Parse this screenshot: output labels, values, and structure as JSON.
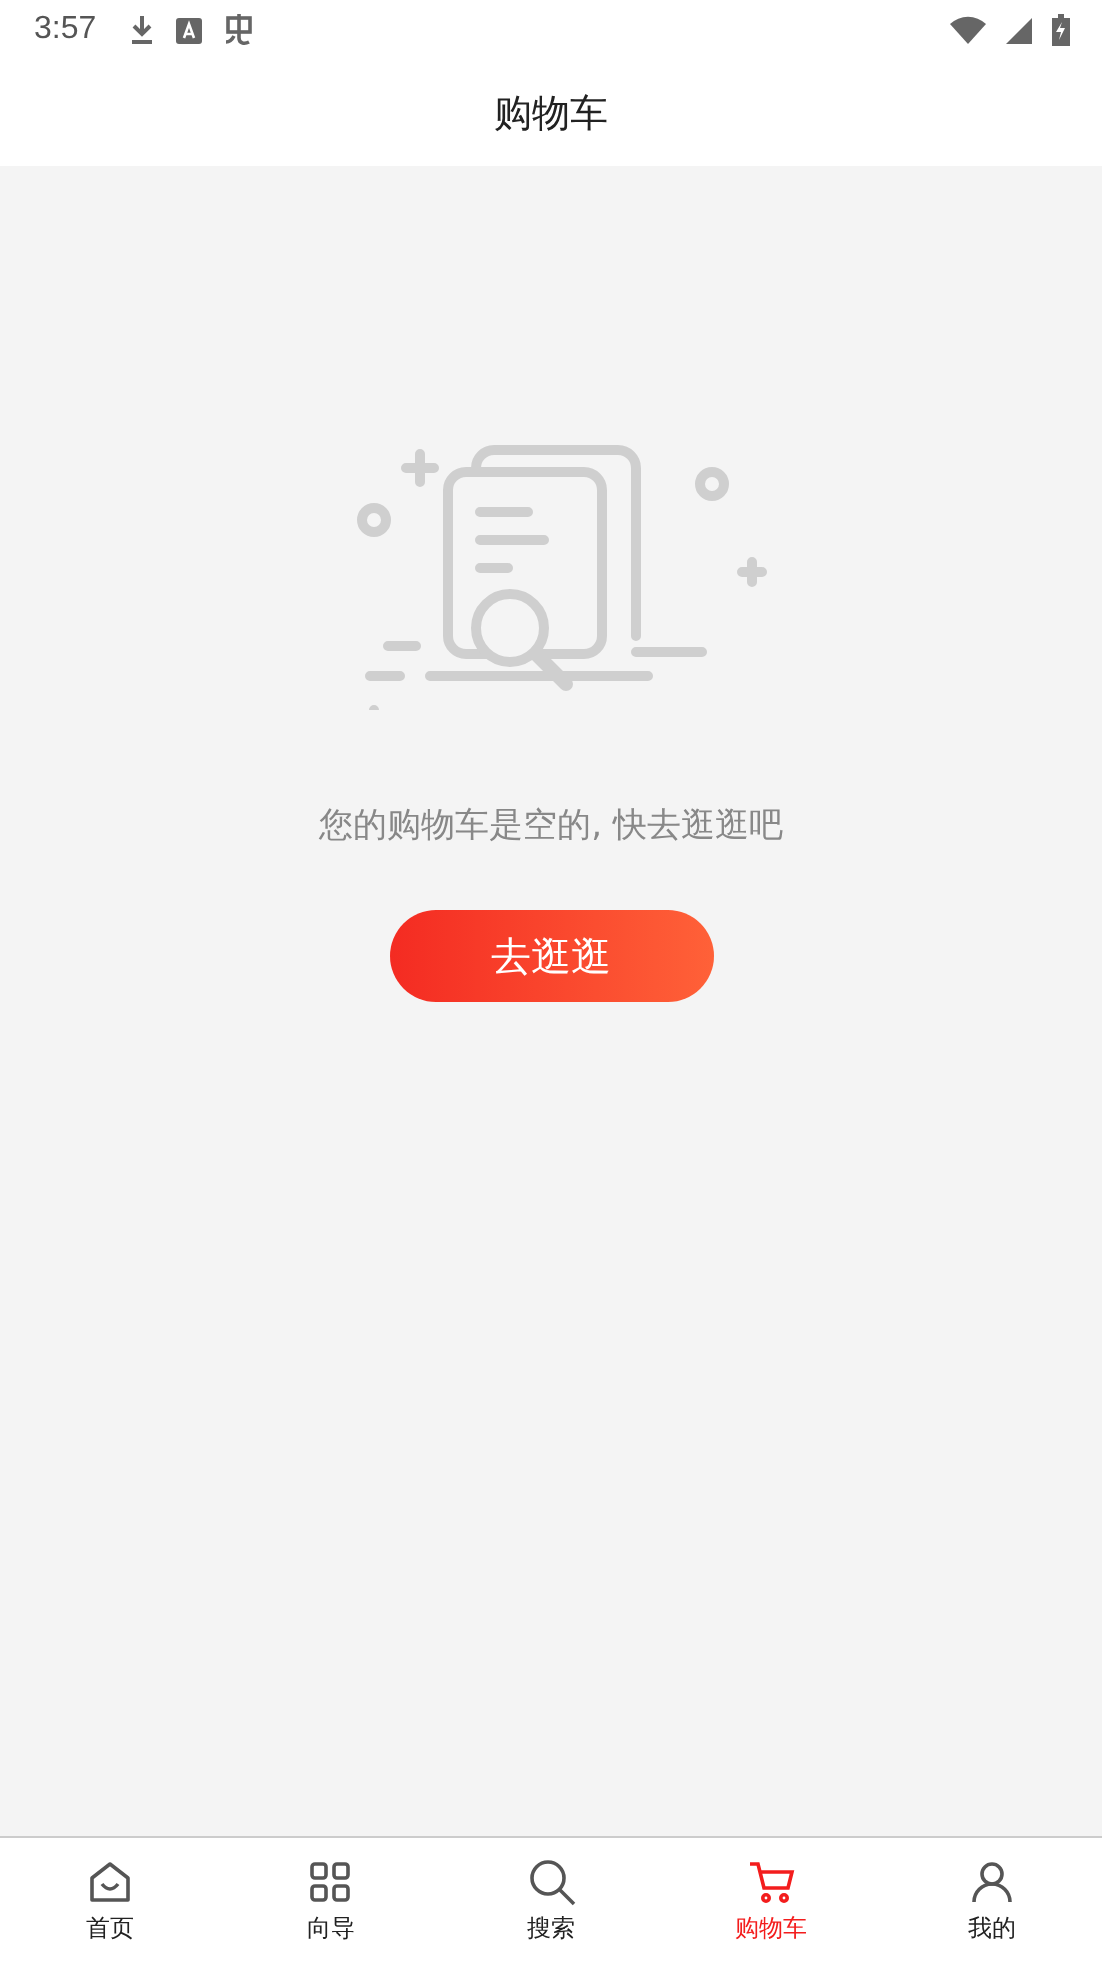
{
  "status_bar": {
    "time": "3:57"
  },
  "header": {
    "title": "购物车"
  },
  "empty_state": {
    "message": "您的购物车是空的, 快去逛逛吧",
    "button": "去逛逛"
  },
  "tab_bar": [
    {
      "label": "首页",
      "selected": false
    },
    {
      "label": "向导",
      "selected": false
    },
    {
      "label": "搜索",
      "selected": false
    },
    {
      "label": "购物车",
      "selected": true
    },
    {
      "label": "我的",
      "selected": false
    }
  ]
}
